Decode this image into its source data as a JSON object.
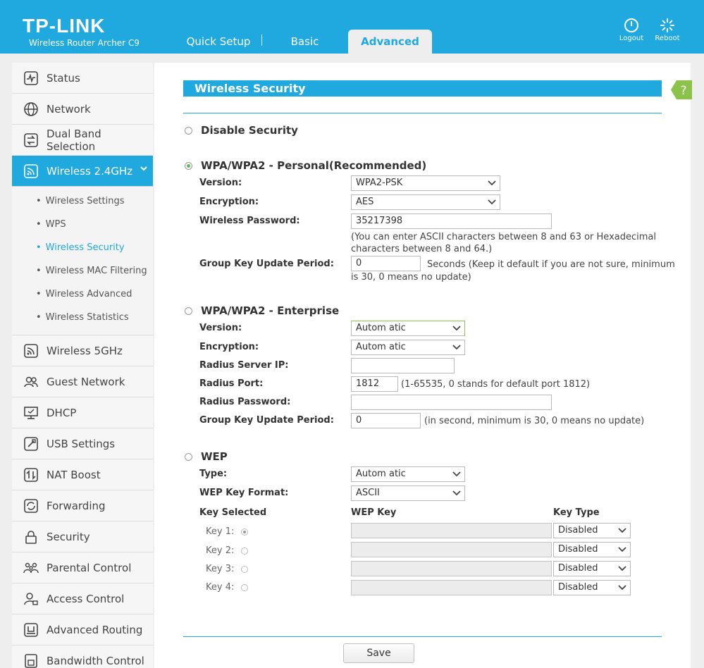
{
  "header": {
    "brand": "TP-LINK",
    "model": "Wireless Router Archer C9",
    "tabs": [
      "Quick Setup",
      "Basic",
      "Advanced"
    ],
    "active_tab": "Advanced",
    "logout_label": "Logout",
    "reboot_label": "Reboot"
  },
  "sidebar": {
    "items_top": [
      "Status",
      "Network",
      "Dual Band Selection"
    ],
    "active_item": "Wireless 2.4GHz",
    "sub_items": [
      "Wireless Settings",
      "WPS",
      "Wireless Security",
      "Wireless MAC Filtering",
      "Wireless Advanced",
      "Wireless Statistics"
    ],
    "active_sub": "Wireless Security",
    "items_bottom": [
      "Wireless 5GHz",
      "Guest Network",
      "DHCP",
      "USB Settings",
      "NAT Boost",
      "Forwarding",
      "Security",
      "Parental Control",
      "Access Control",
      "Advanced Routing",
      "Bandwidth Control"
    ]
  },
  "main": {
    "title": "Wireless Security",
    "help_label": "?",
    "disable": {
      "label": "Disable Security",
      "selected": false
    },
    "personal": {
      "label": "WPA/WPA2 - Personal(Recommended)",
      "selected": true,
      "version_label": "Version:",
      "version_value": "WPA2-PSK",
      "encryption_label": "Encryption:",
      "encryption_value": "AES",
      "password_label": "Wireless Password:",
      "password_value": "35217398",
      "password_note_1": "(You can enter ASCII characters between 8 and 63 or Hexadecimal",
      "password_note_2": "characters between 8 and 64.)",
      "gkup_label": "Group Key Update Period:",
      "gkup_value": "0",
      "gkup_note_1": "Seconds (Keep it default if you are not sure, minimum",
      "gkup_note_2": "is 30, 0 means no update)"
    },
    "enterprise": {
      "label": "WPA/WPA2 - Enterprise",
      "selected": false,
      "version_label": "Version:",
      "version_value": "Autom atic",
      "encryption_label": "Encryption:",
      "encryption_value": "Autom atic",
      "radius_ip_label": "Radius Server IP:",
      "radius_ip_value": "",
      "radius_port_label": "Radius Port:",
      "radius_port_value": "1812",
      "radius_port_note": "(1-65535, 0 stands for default port 1812)",
      "radius_pwd_label": "Radius Password:",
      "radius_pwd_value": "",
      "gkup_label": "Group Key Update Period:",
      "gkup_value": "0",
      "gkup_note": "(in second, minimum is 30, 0 means no update)"
    },
    "wep": {
      "label": "WEP",
      "selected": false,
      "type_label": "Type:",
      "type_value": "Autom atic",
      "format_label": "WEP Key Format:",
      "format_value": "ASCII",
      "col_key_selected": "Key Selected",
      "col_wep_key": "WEP Key",
      "col_key_type": "Key Type",
      "keys": [
        {
          "label": "Key 1:",
          "value": "",
          "type": "Disabled",
          "selected": true
        },
        {
          "label": "Key 2:",
          "value": "",
          "type": "Disabled",
          "selected": false
        },
        {
          "label": "Key 3:",
          "value": "",
          "type": "Disabled",
          "selected": false
        },
        {
          "label": "Key 4:",
          "value": "",
          "type": "Disabled",
          "selected": false
        }
      ]
    },
    "save_label": "Save"
  },
  "colors": {
    "accent": "#1fa9df",
    "radio_selected": "#5cb85c",
    "help_badge": "#8bc34a"
  }
}
